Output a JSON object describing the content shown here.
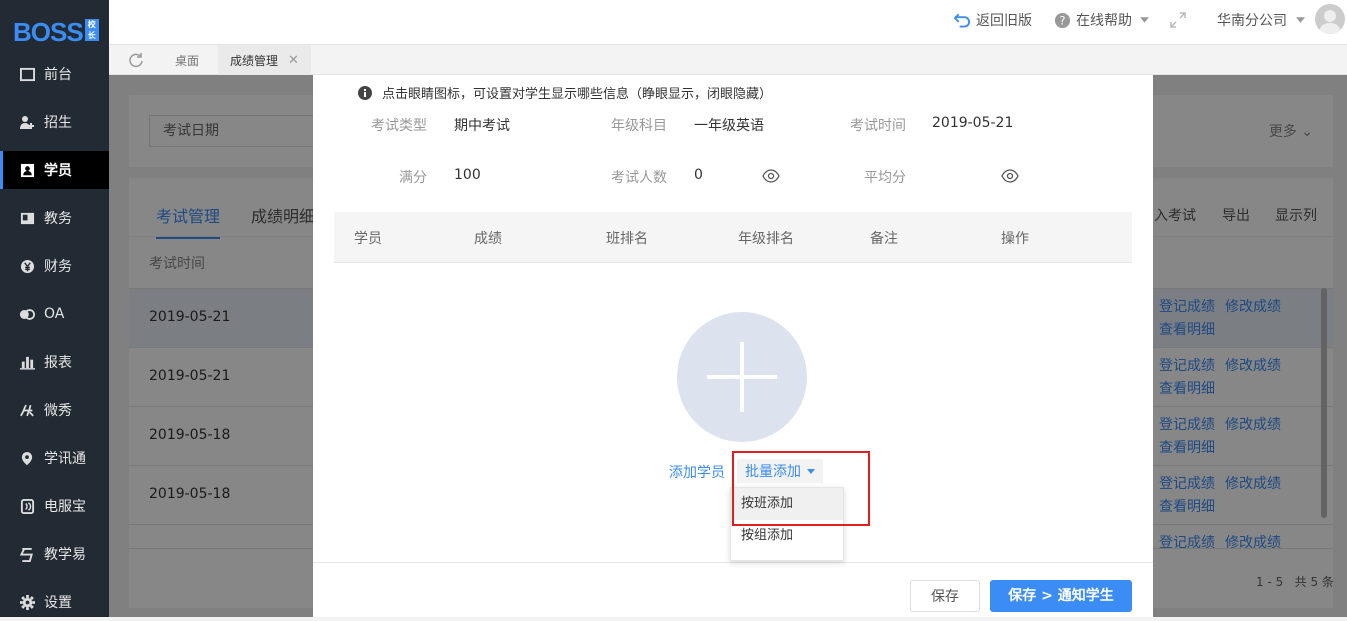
{
  "app": {
    "logo_text": "BOSS",
    "logo_badge": "校长"
  },
  "sidebar": {
    "items": [
      {
        "label": "前台",
        "icon": "desk-icon"
      },
      {
        "label": "招生",
        "icon": "user-plus-icon"
      },
      {
        "label": "学员",
        "icon": "student-card-icon",
        "active": true
      },
      {
        "label": "教务",
        "icon": "book-icon"
      },
      {
        "label": "财务",
        "icon": "yen-icon"
      },
      {
        "label": "OA",
        "icon": "oa-icon"
      },
      {
        "label": "报表",
        "icon": "bar-chart-icon"
      },
      {
        "label": "微秀",
        "icon": "weixiu-icon"
      },
      {
        "label": "学讯通",
        "icon": "location-icon"
      },
      {
        "label": "电服宝",
        "icon": "phone-service-icon"
      },
      {
        "label": "教学易",
        "icon": "teach-icon"
      },
      {
        "label": "设置",
        "icon": "gear-icon"
      }
    ]
  },
  "topbar": {
    "back_old": "返回旧版",
    "help": "在线帮助",
    "company": "华南分公司"
  },
  "tabs": {
    "home": "桌面",
    "current": "成绩管理"
  },
  "background_page": {
    "filter_placeholder": "考试日期",
    "more": "更多",
    "tab_exam": "考试管理",
    "tab_detail": "成绩明细",
    "toolbar_import": "入考试",
    "toolbar_export": "导出",
    "toolbar_columns": "显示列",
    "col_time": "考试时间",
    "rows": [
      {
        "date": "2019-05-21",
        "a1": "登记成绩",
        "a2": "修改成绩",
        "a3": "查看明细"
      },
      {
        "date": "2019-05-21",
        "a1": "登记成绩",
        "a2": "修改成绩",
        "a3": "查看明细"
      },
      {
        "date": "2019-05-18",
        "a1": "登记成绩",
        "a2": "修改成绩",
        "a3": "查看明细"
      },
      {
        "date": "2019-05-18",
        "a1": "登记成绩",
        "a2": "修改成绩",
        "a3": "查看明细"
      },
      {
        "date": "",
        "a1": "登记成绩",
        "a2": "修改成绩",
        "a3": ""
      }
    ],
    "pagination": "1 - 5   共 5 条"
  },
  "modal": {
    "tip": "点击眼睛图标，可设置对学生显示哪些信息（睁眼显示，闭眼隐藏）",
    "exam_type_label": "考试类型",
    "exam_type": "期中考试",
    "grade_subject_label": "年级科目",
    "grade_subject": "一年级英语",
    "exam_time_label": "考试时间",
    "exam_time": "2019-05-21",
    "full_score_label": "满分",
    "full_score": "100",
    "count_label": "考试人数",
    "count": "0",
    "avg_label": "平均分",
    "columns": [
      "学员",
      "成绩",
      "班排名",
      "年级排名",
      "备注",
      "操作"
    ],
    "add_student": "添加学员",
    "batch_add": "批量添加",
    "dropdown": [
      "按班添加",
      "按组添加"
    ],
    "save": "保存",
    "save_notify": "保存 > 通知学生"
  },
  "colors": {
    "accent": "#3b8cf5",
    "sidebar_bg": "#222a33",
    "highlight_border": "#e02020"
  }
}
